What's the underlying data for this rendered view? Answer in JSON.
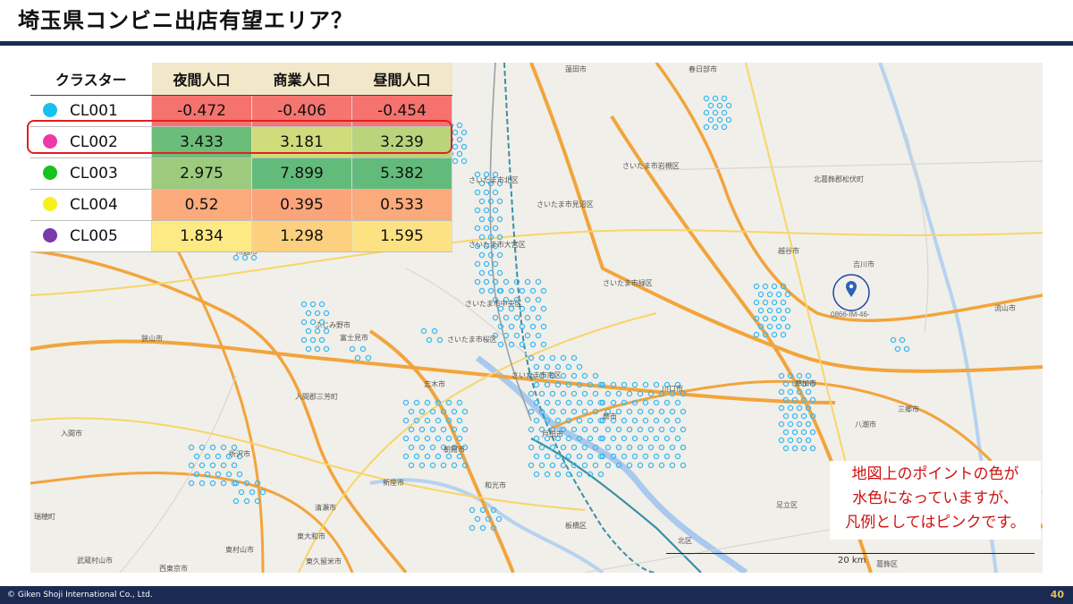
{
  "title": "埼玉県コンビニ出店有望エリア？",
  "table": {
    "headers": [
      "クラスター",
      "夜間人口",
      "商業人口",
      "昼間人口"
    ],
    "rows": [
      {
        "name": "CL001",
        "dot": "#19c1ee",
        "values": [
          "-0.472",
          "-0.406",
          "-0.454"
        ],
        "colors": [
          "#f5736f",
          "#f57570",
          "#f6726e"
        ]
      },
      {
        "name": "CL002",
        "dot": "#ee3aa6",
        "values": [
          "3.433",
          "3.181",
          "3.239"
        ],
        "colors": [
          "#6cbd79",
          "#cfdc7b",
          "#b9d47b"
        ]
      },
      {
        "name": "CL003",
        "dot": "#19c21d",
        "values": [
          "2.975",
          "7.899",
          "5.382"
        ],
        "colors": [
          "#9ccb7e",
          "#63bb7b",
          "#63bb7b"
        ]
      },
      {
        "name": "CL004",
        "dot": "#f7f01c",
        "values": [
          "0.52",
          "0.395",
          "0.533"
        ],
        "colors": [
          "#fbaa7b",
          "#fba47a",
          "#fbaa7b"
        ]
      },
      {
        "name": "CL005",
        "dot": "#7a3aa8",
        "values": [
          "1.834",
          "1.298",
          "1.595"
        ],
        "colors": [
          "#fdea84",
          "#fdd07f",
          "#fde284"
        ]
      }
    ]
  },
  "note": {
    "lines": [
      "地図上のポイントの色が",
      "水色になっていますが、",
      "凡例としてはピンクです。"
    ]
  },
  "map": {
    "point_color": "#39b8f2",
    "labels": [
      "蓮田市",
      "春日部市",
      "さいたま市北区",
      "さいたま市岩槻区",
      "北葛飾郡松伏町",
      "さいたま市見沼区",
      "さいたま市大宮区",
      "越谷市",
      "吉川市",
      "川越市",
      "さいたま市緑区",
      "さいたま市中央区",
      "流山市",
      "ふじみ野市",
      "富士見市",
      "さいたま市桜区",
      "狭山市",
      "さいたま市南区",
      "志木市",
      "川口市",
      "草加市",
      "入間郡三芳町",
      "蕨市",
      "三郷市",
      "戸田市",
      "八潮市",
      "入間市",
      "所沢市",
      "朝霞市",
      "新座市",
      "和光市",
      "足立区",
      "清瀬市",
      "板橋区",
      "東大和市",
      "北区",
      "武蔵村山市",
      "東村山市",
      "東久留米市",
      "葛飾区",
      "西東京市",
      "瑞穂町"
    ],
    "marker_label": "0866-IM-46-",
    "scale": "20 km"
  },
  "footer": {
    "copyright": "© Giken Shoji International Co., Ltd.",
    "page": "40"
  }
}
